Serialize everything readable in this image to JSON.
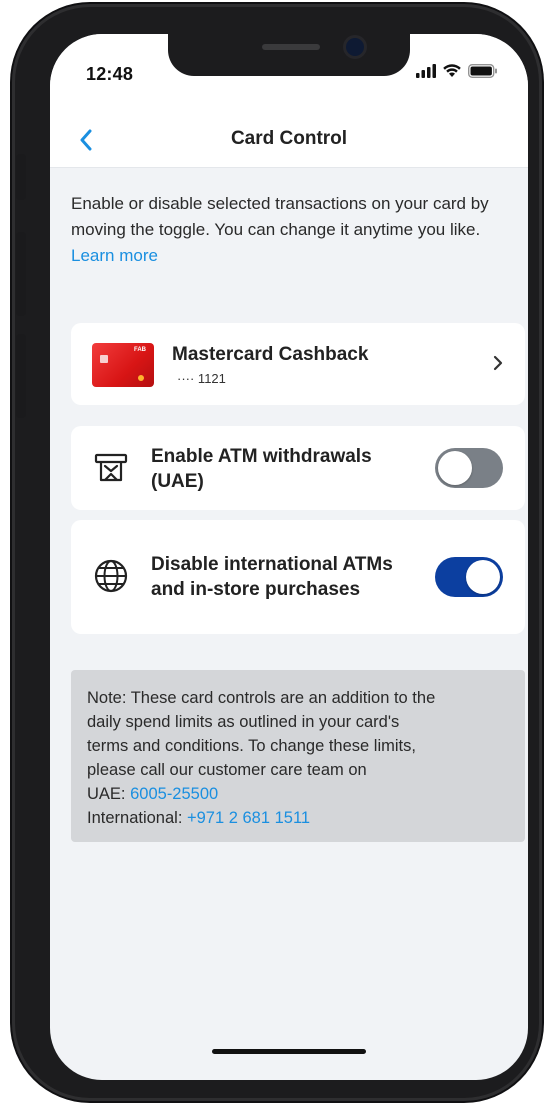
{
  "status_bar": {
    "time": "12:48",
    "icons": [
      "signal-icon",
      "wifi-icon",
      "battery-icon"
    ]
  },
  "header": {
    "title": "Card Control",
    "back_icon": "chevron-left-icon"
  },
  "intro": {
    "text": "Enable or disable selected transactions on your card by moving the toggle. You can change it anytime you like.",
    "learn_more": "Learn more"
  },
  "card": {
    "name": "Mastercard Cashback",
    "number": "···· 1121",
    "brand_text": "FAB",
    "chevron_icon": "chevron-right-icon"
  },
  "controls": [
    {
      "label": "Enable ATM withdrawals (UAE)",
      "icon": "atm-icon",
      "enabled": false
    },
    {
      "label": "Disable international ATMs and in-store purchases",
      "icon": "globe-icon",
      "enabled": true
    }
  ],
  "note": {
    "lines": [
      "Note: These card controls are an addition to the",
      "daily spend limits as outlined in your card's",
      "terms and conditions. To change these limits,",
      "please call our customer care team on"
    ],
    "uae_label": "UAE: ",
    "uae_number": "6005-25500",
    "intl_label": "International: ",
    "intl_number": "+971 2 681 1511"
  },
  "colors": {
    "accent_link": "#1a8fe0",
    "toggle_on": "#0c3fa0",
    "toggle_off": "#7a8087",
    "card_red": "#e02020",
    "screen_bg": "#f1f3f6",
    "note_bg": "#d4d6d9"
  }
}
